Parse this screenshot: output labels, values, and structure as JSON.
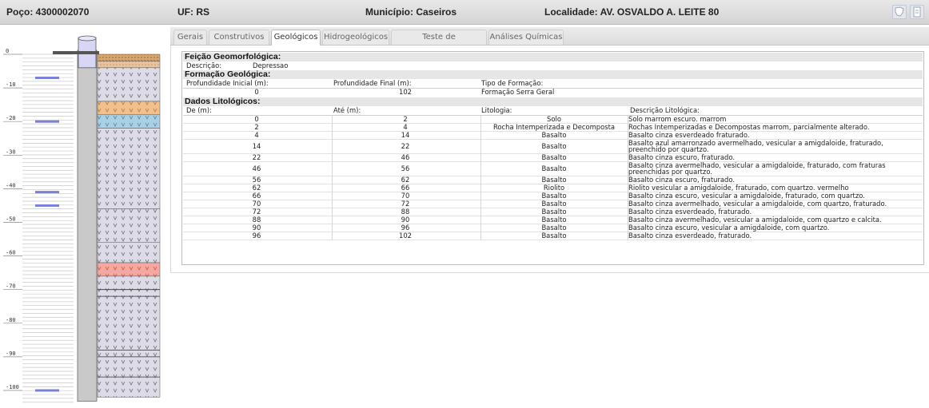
{
  "header": {
    "poco": "Poço: 4300002070",
    "uf": "UF: RS",
    "municipio": "Município: Caseiros",
    "localidade": "Localidade: AV. OSVALDO A. LEITE 80",
    "icons": [
      "map-icon",
      "document-icon"
    ]
  },
  "profile": {
    "depth_labels": [
      "0",
      "-10",
      "-20",
      "-30",
      "-40",
      "-50",
      "-60",
      "-70",
      "-80",
      "-90",
      "-100"
    ],
    "casing_color": "#7b7fd8",
    "water_marks_depth": [
      -7,
      -20,
      -41,
      -45,
      -100
    ]
  },
  "tabs": [
    {
      "label": "Gerais",
      "active": false
    },
    {
      "label": "Construtivos",
      "active": false
    },
    {
      "label": "Geológicos",
      "active": true
    },
    {
      "label": "Hidrogeológicos",
      "active": false
    },
    {
      "label": "Teste de Bombeamento",
      "active": false
    },
    {
      "label": "Análises Químicas",
      "active": false
    }
  ],
  "geomorf": {
    "title": "Feição Geomorfológica:",
    "desc_label": "Descrição:",
    "desc_value": "Depressao"
  },
  "formacao": {
    "title": "Formação Geológica:",
    "headers": [
      "Profundidade Inicial (m):",
      "Profundidade Final (m):",
      "Tipo de Formação:"
    ],
    "row": [
      "0",
      "102",
      "Formação Serra Geral"
    ]
  },
  "lito": {
    "title": "Dados Litológicos:",
    "headers": [
      "De (m):",
      "Até (m):",
      "Litologia:",
      "Descrição Litológica:"
    ],
    "rows": [
      {
        "de": "0",
        "ate": "2",
        "lit": "Solo",
        "desc": "Solo marrom escuro. marrom",
        "desc2": ""
      },
      {
        "de": "2",
        "ate": "4",
        "lit": "Rocha Intemperizada e Decomposta",
        "desc": "Rochas Intemperizadas e Decompostas marrom, parcialmente alterado.",
        "desc2": ""
      },
      {
        "de": "4",
        "ate": "14",
        "lit": "Basalto",
        "desc": "Basalto cinza esverdeado fraturado.",
        "desc2": ""
      },
      {
        "de": "14",
        "ate": "22",
        "lit": "Basalto",
        "desc": "Basalto azul amarronzado avermelhado, vesicular a amigdaloide, fraturado,",
        "desc2": "preenchido por quartzo."
      },
      {
        "de": "22",
        "ate": "46",
        "lit": "Basalto",
        "desc": "Basalto cinza escuro, fraturado.",
        "desc2": ""
      },
      {
        "de": "46",
        "ate": "56",
        "lit": "Basalto",
        "desc": "Basalto cinza avermelhado, vesicular a amigdaloide, fraturado, com fraturas",
        "desc2": "preenchidas por quartzo."
      },
      {
        "de": "56",
        "ate": "62",
        "lit": "Basalto",
        "desc": "Basalto cinza escuro, fraturado.",
        "desc2": ""
      },
      {
        "de": "62",
        "ate": "66",
        "lit": "Riolito",
        "desc": "Riolito vesicular a amigdaloide, fraturado, com quartzo. vermelho",
        "desc2": ""
      },
      {
        "de": "66",
        "ate": "70",
        "lit": "Basalto",
        "desc": "Basalto cinza escuro, vesicular a amigdaloide, fraturado, com quartzo.",
        "desc2": ""
      },
      {
        "de": "70",
        "ate": "72",
        "lit": "Basalto",
        "desc": "Basalto cinza avermelhado, vesicular a amigdaloide, com quartzo, fraturado.",
        "desc2": ""
      },
      {
        "de": "72",
        "ate": "88",
        "lit": "Basalto",
        "desc": "Basalto cinza esverdeado, fraturado.",
        "desc2": ""
      },
      {
        "de": "88",
        "ate": "90",
        "lit": "Basalto",
        "desc": "Basalto cinza avermelhado, vesicular a amigdaloide, com quartzo e calcita.",
        "desc2": ""
      },
      {
        "de": "90",
        "ate": "96",
        "lit": "Basalto",
        "desc": "Basalto cinza escuro, vesicular a amigdaloide, com quartzo.",
        "desc2": ""
      },
      {
        "de": "96",
        "ate": "102",
        "lit": "Basalto",
        "desc": "Basalto cinza esverdeado, fraturado.",
        "desc2": ""
      }
    ]
  }
}
